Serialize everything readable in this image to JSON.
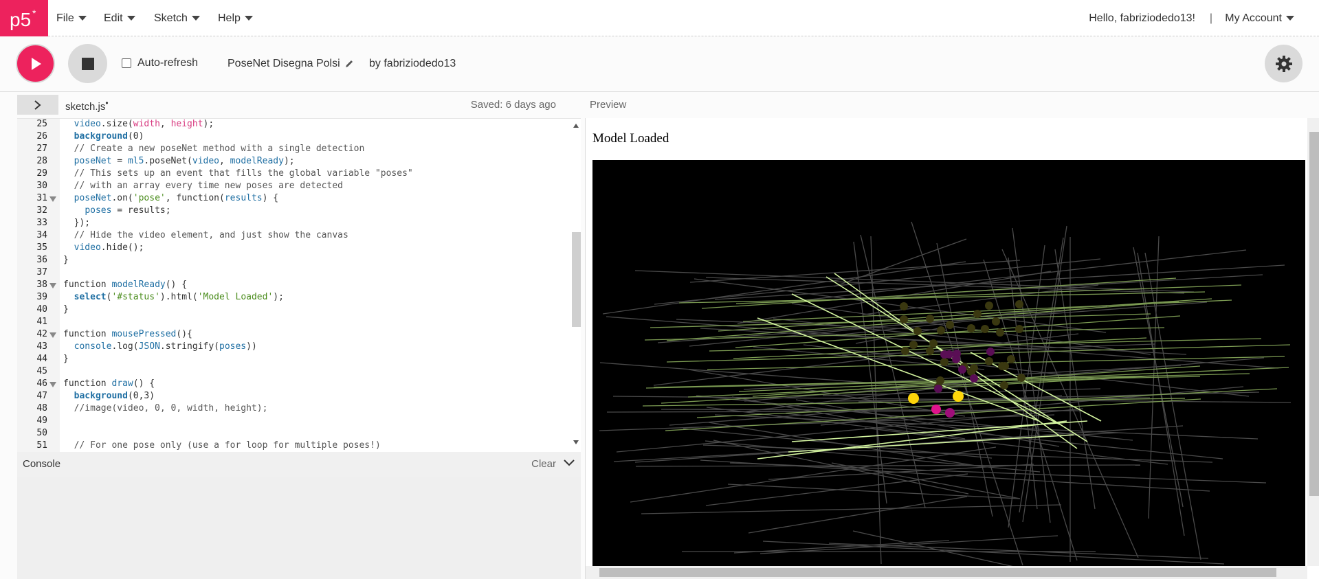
{
  "nav": {
    "logo_text": "p5*",
    "menus": [
      {
        "label": "File"
      },
      {
        "label": "Edit"
      },
      {
        "label": "Sketch"
      },
      {
        "label": "Help"
      }
    ],
    "greeting": "Hello, fabriziodedo13!",
    "separator": "|",
    "account_label": "My Account"
  },
  "toolbar": {
    "autorefresh_label": "Auto-refresh",
    "autorefresh_checked": false,
    "project_name": "PoseNet Disegna Polsi",
    "author": "by fabriziodedo13"
  },
  "editor": {
    "file_name": "sketch.js",
    "unsaved_dot": "•",
    "saved_status": "Saved: 6 days ago",
    "lines": [
      {
        "n": "25",
        "fold": false
      },
      {
        "n": "26",
        "fold": false
      },
      {
        "n": "27",
        "fold": false
      },
      {
        "n": "28",
        "fold": false
      },
      {
        "n": "29",
        "fold": false
      },
      {
        "n": "30",
        "fold": false
      },
      {
        "n": "31",
        "fold": true
      },
      {
        "n": "32",
        "fold": false
      },
      {
        "n": "33",
        "fold": false
      },
      {
        "n": "34",
        "fold": false
      },
      {
        "n": "35",
        "fold": false
      },
      {
        "n": "36",
        "fold": false
      },
      {
        "n": "37",
        "fold": false
      },
      {
        "n": "38",
        "fold": true
      },
      {
        "n": "39",
        "fold": false
      },
      {
        "n": "40",
        "fold": false
      },
      {
        "n": "41",
        "fold": false
      },
      {
        "n": "42",
        "fold": true
      },
      {
        "n": "43",
        "fold": false
      },
      {
        "n": "44",
        "fold": false
      },
      {
        "n": "45",
        "fold": false
      },
      {
        "n": "46",
        "fold": true
      },
      {
        "n": "47",
        "fold": false
      },
      {
        "n": "48",
        "fold": false
      },
      {
        "n": "49",
        "fold": false
      },
      {
        "n": "50",
        "fold": false
      },
      {
        "n": "51",
        "fold": false
      }
    ],
    "code": {
      "l25": {
        "a": "  ",
        "b": "video",
        "c": ".size(",
        "d": "width",
        "e": ", ",
        "f": "height",
        "g": ");"
      },
      "l26": {
        "a": "  ",
        "b": "background",
        "c": "(0)"
      },
      "l27": {
        "a": "  ",
        "b": "// Create a new poseNet method with a single detection"
      },
      "l28": {
        "a": "  ",
        "b": "poseNet",
        "c": " = ",
        "d": "ml5",
        "e": ".poseNet(",
        "f": "video",
        "g": ", ",
        "h": "modelReady",
        "i": ");"
      },
      "l29": {
        "a": "  ",
        "b": "// This sets up an event that fills the global variable \"poses\""
      },
      "l30": {
        "a": "  ",
        "b": "// with an array every time new poses are detected"
      },
      "l31": {
        "a": "  ",
        "b": "poseNet",
        "c": ".on(",
        "d": "'pose'",
        "e": ", ",
        "f": "function",
        "g": "(",
        "h": "results",
        "i": ") {"
      },
      "l32": {
        "a": "    ",
        "b": "poses",
        "c": " = results;"
      },
      "l33": {
        "a": "  });"
      },
      "l34": {
        "a": "  ",
        "b": "// Hide the video element, and just show the canvas"
      },
      "l35": {
        "a": "  ",
        "b": "video",
        "c": ".hide();"
      },
      "l36": {
        "a": "}"
      },
      "l38": {
        "a": "function",
        "b": " ",
        "c": "modelReady",
        "d": "() {"
      },
      "l39": {
        "a": "  ",
        "b": "select",
        "c": "(",
        "d": "'#status'",
        "e": ").html(",
        "f": "'Model Loaded'",
        "g": ");"
      },
      "l40": {
        "a": "}"
      },
      "l42": {
        "a": "function",
        "b": " ",
        "c": "mousePressed",
        "d": "(){"
      },
      "l43": {
        "a": "  ",
        "b": "console",
        "c": ".log(",
        "d": "JSON",
        "e": ".stringify(",
        "f": "poses",
        "g": "))"
      },
      "l44": {
        "a": "}"
      },
      "l46": {
        "a": "function",
        "b": " ",
        "c": "draw",
        "d": "() {"
      },
      "l47": {
        "a": "  ",
        "b": "background",
        "c": "(0,3)"
      },
      "l48": {
        "a": "  ",
        "b": "//image(video, 0, 0, width, height);"
      },
      "l51": {
        "a": "  ",
        "b": "// For one pose only (use a for loop for multiple poses!)"
      }
    }
  },
  "console": {
    "title": "Console",
    "clear_label": "Clear"
  },
  "preview": {
    "label": "Preview",
    "status_text": "Model Loaded"
  },
  "colors": {
    "brand": "#ed225d",
    "keyword": "#1f6fa3",
    "argument": "#d83a80",
    "string": "#4a8c1c"
  },
  "icons": {
    "play": "play-icon",
    "stop": "stop-icon",
    "gear": "gear-icon",
    "pencil": "pencil-icon",
    "sidebar": "chevron-right-icon",
    "console_toggle": "chevron-down-icon"
  }
}
